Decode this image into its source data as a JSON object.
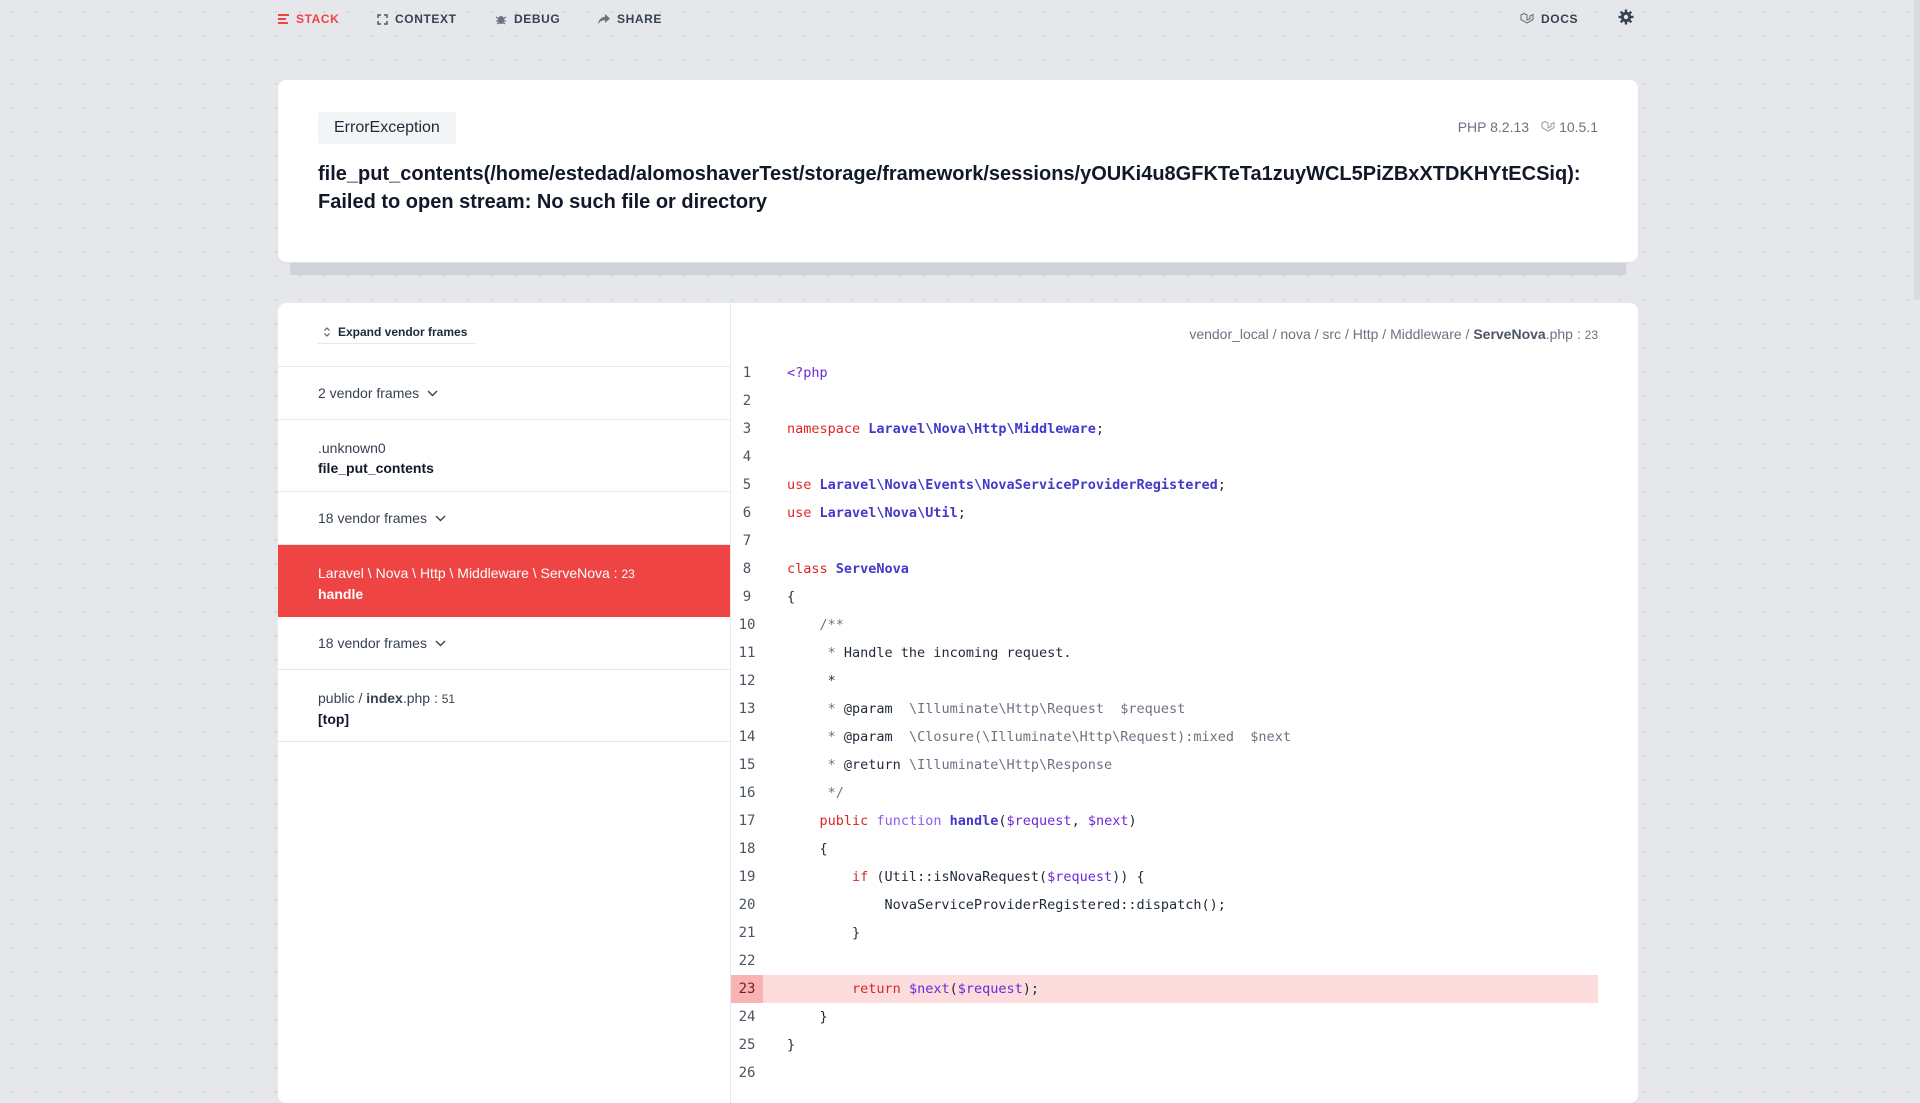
{
  "nav": {
    "stack": "STACK",
    "context": "CONTEXT",
    "debug": "DEBUG",
    "share": "SHARE",
    "docs": "DOCS"
  },
  "header": {
    "exception_class": "ErrorException",
    "php_version": "PHP 8.2.13",
    "laravel_version": "10.5.1",
    "message_line1": "file_put_contents(/home/estedad/alomoshaverTest/storage/framework/sessions/yOUKi4u8GFKTeTa1zuyWCL5PiZBxXTDKHYtECSiq):",
    "message_line2": "Failed to open stream: No such file or directory"
  },
  "frames": {
    "expand_label": "Expand vendor frames",
    "vendor_group_1": "2 vendor frames",
    "frame_unknown": {
      "class": ".unknown0",
      "method": "file_put_contents"
    },
    "vendor_group_2": "18 vendor frames",
    "frame_selected": {
      "class": "Laravel \\ Nova \\ Http \\ Middleware \\ ServeNova",
      "line": "23",
      "method": "handle"
    },
    "vendor_group_3": "18 vendor frames",
    "frame_index": {
      "path": "public / ",
      "file": "index",
      "ext": ".php",
      "line": "51",
      "method": "[top]"
    }
  },
  "code": {
    "breadcrumb": {
      "path": "vendor_local / nova / src / Http / Middleware / ",
      "file": "ServeNova",
      "ext": ".php",
      "line": "23"
    },
    "highlight_line": 23,
    "line_numbers": [
      "1",
      "2",
      "3",
      "4",
      "5",
      "6",
      "7",
      "8",
      "9",
      "10",
      "11",
      "12",
      "13",
      "14",
      "15",
      "16",
      "17",
      "18",
      "19",
      "20",
      "21",
      "22",
      "23",
      "24",
      "25",
      "26"
    ]
  },
  "colors": {
    "accent": "#ef4444",
    "highlight_bg": "#fcdcdc",
    "keyword": "#dc2626",
    "namespace": "#4338ca",
    "variable": "#6d28d9"
  }
}
